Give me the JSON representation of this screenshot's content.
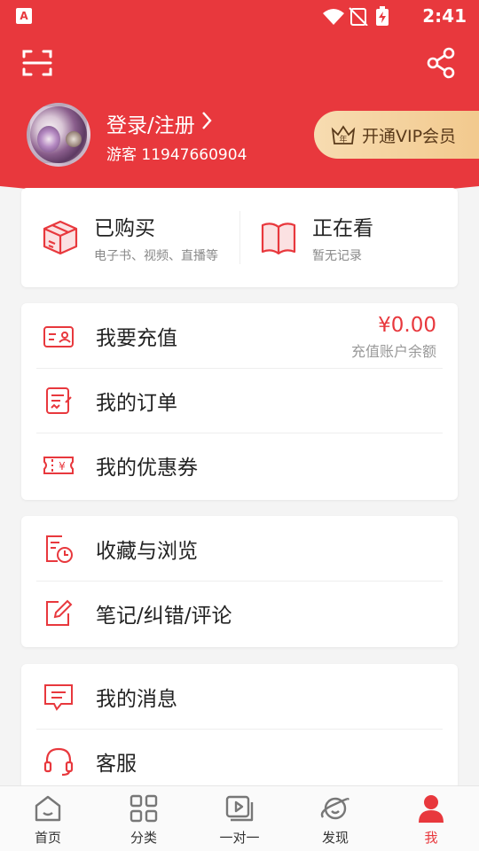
{
  "status_bar": {
    "time": "2:41",
    "app_icon_letter": "A"
  },
  "header": {
    "login_label": "登录/注册",
    "guest_id": "游客 11947660904",
    "vip_label": "开通VIP会员",
    "vip_crown_char": "年"
  },
  "top_card": {
    "purchased": {
      "title": "已购买",
      "subtitle": "电子书、视频、直播等"
    },
    "watching": {
      "title": "正在看",
      "subtitle": "暂无记录"
    }
  },
  "menu_a": {
    "recharge": {
      "label": "我要充值",
      "amount": "¥0.00",
      "amount_label": "充值账户余额"
    },
    "orders": {
      "label": "我的订单"
    },
    "coupons": {
      "label": "我的优惠券",
      "icon_char": "¥"
    }
  },
  "menu_b": {
    "favorites": {
      "label": "收藏与浏览"
    },
    "notes": {
      "label": "笔记/纠错/评论"
    }
  },
  "menu_c": {
    "messages": {
      "label": "我的消息"
    },
    "service": {
      "label": "客服"
    }
  },
  "tabbar": [
    {
      "label": "首页",
      "icon": "home-icon"
    },
    {
      "label": "分类",
      "icon": "grid-icon"
    },
    {
      "label": "一对一",
      "icon": "video-icon"
    },
    {
      "label": "发现",
      "icon": "planet-icon"
    },
    {
      "label": "我",
      "icon": "user-icon",
      "active": true
    }
  ],
  "colors": {
    "accent": "#e8383d",
    "vip_gold": "#f2c98d"
  }
}
